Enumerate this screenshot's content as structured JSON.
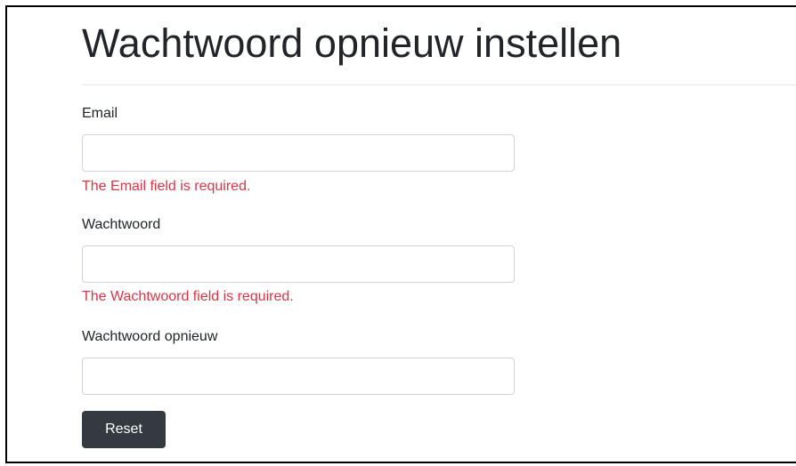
{
  "page": {
    "title": "Wachtwoord opnieuw instellen"
  },
  "form": {
    "email": {
      "label": "Email",
      "value": "",
      "error": "The Email field is required."
    },
    "password": {
      "label": "Wachtwoord",
      "value": "",
      "error": "The Wachtwoord field is required."
    },
    "confirm_password": {
      "label": "Wachtwoord opnieuw",
      "value": ""
    },
    "submit_label": "Reset"
  },
  "colors": {
    "error": "#dc3545",
    "button_background": "#343a40",
    "input_border": "#ced4da"
  }
}
